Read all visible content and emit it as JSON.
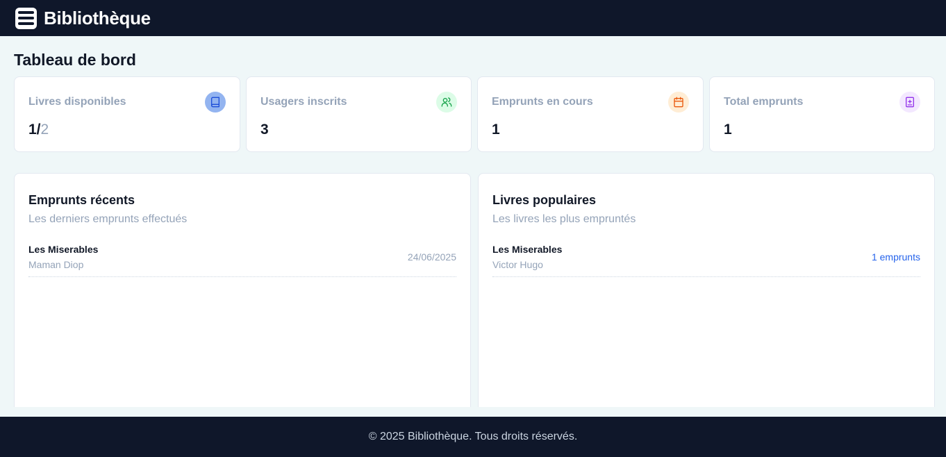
{
  "header": {
    "title": "Bibliothèque",
    "logo_icon": "menu-lines-icon"
  },
  "page": {
    "title": "Tableau de bord"
  },
  "stats": [
    {
      "label": "Livres disponibles",
      "value": "1/",
      "value_muted": "2",
      "icon": "book-icon",
      "icon_bg": "#93b4f0",
      "icon_color": "#1d4ed8"
    },
    {
      "label": "Usagers inscrits",
      "value": "3",
      "icon": "users-icon",
      "icon_bg": "#dcfce7",
      "icon_color": "#16a34a"
    },
    {
      "label": "Emprunts en cours",
      "value": "1",
      "icon": "calendar-icon",
      "icon_bg": "#ffedd5",
      "icon_color": "#ea580c"
    },
    {
      "label": "Total emprunts",
      "value": "1",
      "icon": "book-plus-icon",
      "icon_bg": "#f3e8ff",
      "icon_color": "#9333ea"
    }
  ],
  "recent_loans": {
    "title": "Emprunts récents",
    "subtitle": "Les derniers emprunts effectués",
    "items": [
      {
        "book": "Les Miserables",
        "user": "Maman Diop",
        "date": "24/06/2025"
      }
    ]
  },
  "popular_books": {
    "title": "Livres populaires",
    "subtitle": "Les livres les plus empruntés",
    "items": [
      {
        "book": "Les Miserables",
        "author": "Victor Hugo",
        "count": "1 emprunts"
      }
    ]
  },
  "footer": {
    "text": "© 2025 Bibliothèque. Tous droits réservés."
  },
  "colors": {
    "nav_bg": "#0f172a",
    "page_bg": "#eff7f8",
    "link": "#2563eb",
    "muted": "#94a3b8"
  }
}
